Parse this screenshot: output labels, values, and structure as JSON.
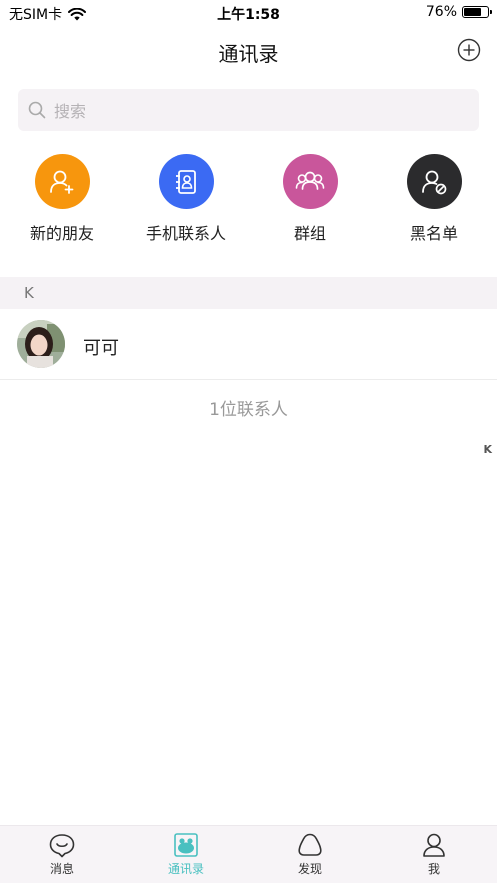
{
  "status_bar": {
    "carrier": "无SIM卡",
    "time": "上午1:58",
    "battery_percent": "76%",
    "battery_level": 0.76
  },
  "nav": {
    "title": "通讯录",
    "add_icon": "plus-circle-icon"
  },
  "search": {
    "placeholder": "搜索"
  },
  "quick_actions": [
    {
      "label": "新的朋友",
      "icon": "add-user-icon",
      "color": "#f7960d"
    },
    {
      "label": "手机联系人",
      "icon": "address-book-icon",
      "color": "#3b6af3"
    },
    {
      "label": "群组",
      "icon": "group-icon",
      "color": "#c9569b"
    },
    {
      "label": "黑名单",
      "icon": "blocked-user-icon",
      "color": "#2b2b2d"
    }
  ],
  "contacts": {
    "section_letter": "K",
    "items": [
      {
        "name": "可可"
      }
    ],
    "count_text": "1位联系人"
  },
  "index_bar": [
    "K"
  ],
  "tab_bar": {
    "active_color": "#49c0c0",
    "items": [
      {
        "label": "消息",
        "icon": "chat-icon"
      },
      {
        "label": "通讯录",
        "icon": "contacts-icon",
        "active": true
      },
      {
        "label": "发现",
        "icon": "discover-icon"
      },
      {
        "label": "我",
        "icon": "profile-icon"
      }
    ]
  }
}
